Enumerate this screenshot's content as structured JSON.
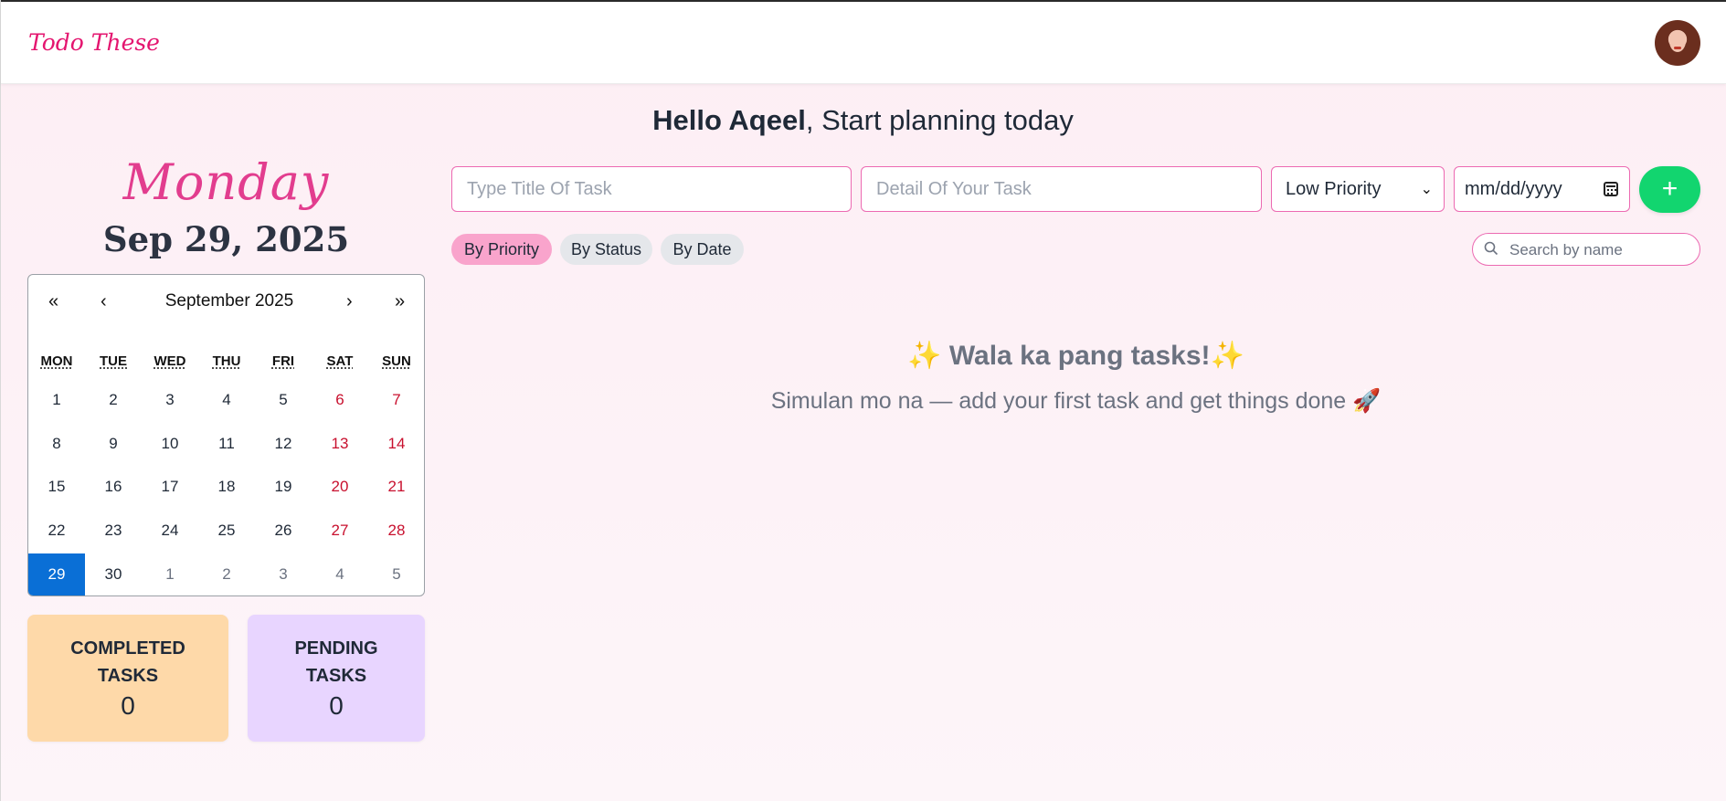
{
  "header": {
    "logo": "Todo These"
  },
  "greeting": {
    "name": "Hello Aqeel",
    "rest": ", Start planning today"
  },
  "today": {
    "weekday": "Monday",
    "date": "Sep 29, 2025"
  },
  "calendar": {
    "title": "September 2025",
    "nav": {
      "prev_year": "«",
      "prev_month": "‹",
      "next_month": "›",
      "next_year": "»"
    },
    "weekdays": [
      "MON",
      "TUE",
      "WED",
      "THU",
      "FRI",
      "SAT",
      "SUN"
    ],
    "weeks": [
      [
        "1",
        "2",
        "3",
        "4",
        "5",
        "6",
        "7"
      ],
      [
        "8",
        "9",
        "10",
        "11",
        "12",
        "13",
        "14"
      ],
      [
        "15",
        "16",
        "17",
        "18",
        "19",
        "20",
        "21"
      ],
      [
        "22",
        "23",
        "24",
        "25",
        "26",
        "27",
        "28"
      ],
      [
        "29",
        "30",
        "1",
        "2",
        "3",
        "4",
        "5"
      ]
    ],
    "selected": "29"
  },
  "stats": {
    "completed": {
      "label": "COMPLETED TASKS",
      "value": "0"
    },
    "pending": {
      "label": "PENDING TASKS",
      "value": "0"
    }
  },
  "form": {
    "title_placeholder": "Type Title Of Task",
    "detail_placeholder": "Detail Of Your Task",
    "priority_value": "Low Priority",
    "date_placeholder": "mm/dd/yyyy",
    "add_label": "+"
  },
  "filters": {
    "priority": "By Priority",
    "status": "By Status",
    "date": "By Date"
  },
  "search": {
    "placeholder": "Search by name"
  },
  "empty": {
    "title": "Wala ka pang tasks!",
    "sparkle": "✨",
    "subtitle": "Simulan mo na — add your first task and get things done",
    "rocket": "🚀"
  }
}
